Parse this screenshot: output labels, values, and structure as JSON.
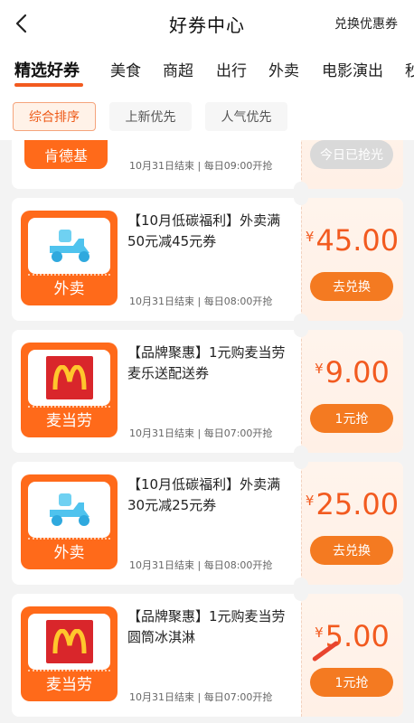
{
  "header": {
    "title": "好券中心",
    "redeem_label": "兑换优惠券"
  },
  "tabs": [
    "精选好券",
    "美食",
    "商超",
    "出行",
    "外卖",
    "电影演出",
    "秒"
  ],
  "sorts": [
    "综合排序",
    "上新优先",
    "人气优先"
  ],
  "coupons": [
    {
      "brand": "肯德基",
      "meta": "10月31日结束 | 每日09:00开抢",
      "button": "今日已抢光",
      "state": "sold-out"
    },
    {
      "brand": "外卖",
      "title": "【10月低碳福利】外卖满50元减45元券",
      "meta": "10月31日结束 | 每日08:00开抢",
      "currency": "¥",
      "price": "45.00",
      "button": "去兑换",
      "icon": "scooter-icon"
    },
    {
      "brand": "麦当劳",
      "title": "【品牌聚惠】1元购麦当劳麦乐送配送券",
      "meta": "10月31日结束 | 每日07:00开抢",
      "currency": "¥",
      "price": "9.00",
      "button": "1元抢",
      "icon": "mcdonalds-logo-icon"
    },
    {
      "brand": "外卖",
      "title": "【10月低碳福利】外卖满30元减25元券",
      "meta": "10月31日结束 | 每日08:00开抢",
      "currency": "¥",
      "price": "25.00",
      "button": "去兑换",
      "icon": "scooter-icon"
    },
    {
      "brand": "麦当劳",
      "title": "【品牌聚惠】1元购麦当劳圆筒冰淇淋",
      "meta": "10月31日结束 | 每日07:00开抢",
      "currency": "¥",
      "price": "5.00",
      "button": "1元抢",
      "icon": "mcdonalds-logo-icon"
    }
  ],
  "colors": {
    "accent": "#f25a1f",
    "button": "#f47a21",
    "mcd_red": "#d9262b",
    "mcd_yellow": "#ffc72c"
  }
}
